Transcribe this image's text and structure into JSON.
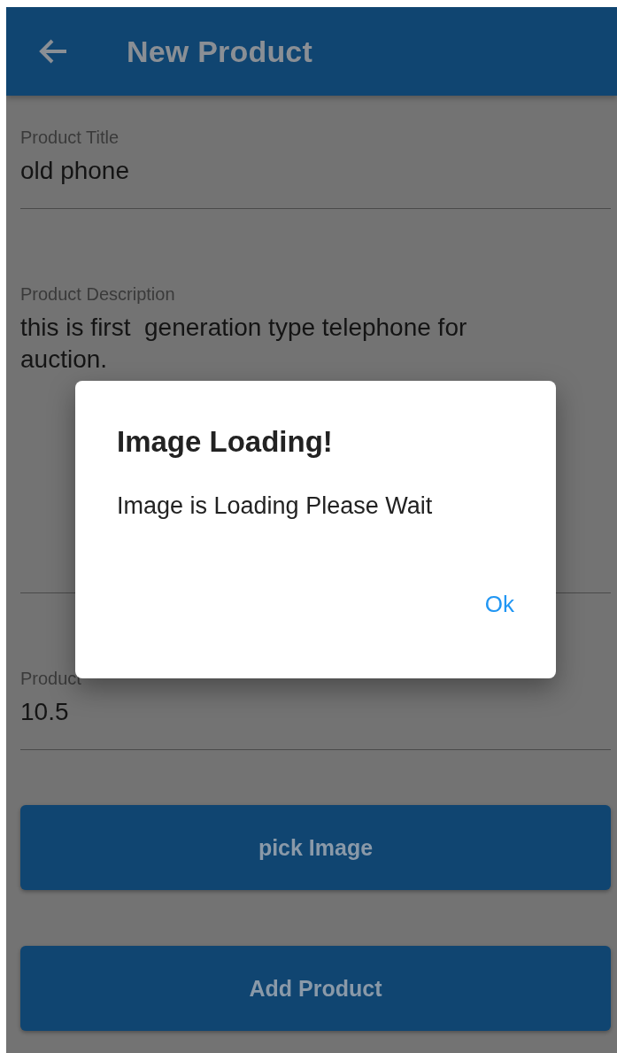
{
  "app_bar": {
    "title": "New Product"
  },
  "fields": [
    {
      "label": "Product Title",
      "value": "old phone",
      "kind": "single"
    },
    {
      "label": "Product Description",
      "value": "this is first  generation type telephone for auction.",
      "kind": "multiline"
    },
    {
      "label": "Product",
      "value": "10.5",
      "kind": "single"
    }
  ],
  "buttons": [
    "pick Image",
    "Add Product"
  ],
  "dialog": {
    "title": "Image Loading!",
    "message": "Image is Loading Please Wait",
    "action": "Ok"
  }
}
